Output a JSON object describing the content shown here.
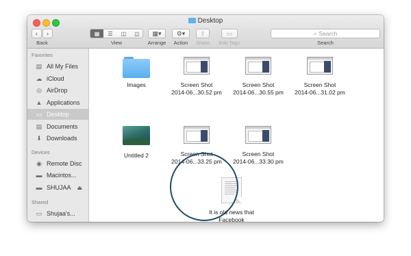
{
  "window": {
    "title": "Desktop"
  },
  "toolbar": {
    "back_label": "Back",
    "view_label": "View",
    "arrange_label": "Arrange",
    "action_label": "Action",
    "share_label": "Share",
    "edit_tags_label": "Edit Tags",
    "search_label": "Search",
    "search_placeholder": "Search"
  },
  "sidebar": {
    "sections": [
      {
        "title": "Favorites",
        "items": [
          {
            "label": "All My Files",
            "icon": "all-files-icon"
          },
          {
            "label": "iCloud",
            "icon": "cloud-icon"
          },
          {
            "label": "AirDrop",
            "icon": "airdrop-icon"
          },
          {
            "label": "Applications",
            "icon": "applications-icon"
          },
          {
            "label": "Desktop",
            "icon": "desktop-icon",
            "selected": true
          },
          {
            "label": "Documents",
            "icon": "documents-icon"
          },
          {
            "label": "Downloads",
            "icon": "downloads-icon"
          }
        ]
      },
      {
        "title": "Devices",
        "items": [
          {
            "label": "Remote Disc",
            "icon": "disc-icon"
          },
          {
            "label": "Macintos...",
            "icon": "hard-drive-icon"
          },
          {
            "label": "SHUJAA",
            "icon": "usb-drive-icon",
            "eject": true
          }
        ]
      },
      {
        "title": "Shared",
        "items": [
          {
            "label": "Shujaa's...",
            "icon": "computer-icon"
          }
        ]
      }
    ]
  },
  "files": [
    {
      "name": "Images",
      "type": "folder"
    },
    {
      "name": "Screen Shot",
      "name2": "2014-06...30.52 pm",
      "type": "screenshot"
    },
    {
      "name": "Screen Shot",
      "name2": "2014-06...30.55 pm",
      "type": "screenshot"
    },
    {
      "name": "Screen Shot",
      "name2": "2014-06...31.02 pm",
      "type": "screenshot"
    },
    {
      "name": "Untitled 2",
      "type": "image"
    },
    {
      "name": "Screen Shot",
      "name2": "2014-06...33.25 pm",
      "type": "screenshot"
    },
    {
      "name": "Screen Shot",
      "name2": "2014-06...33.30 pm",
      "type": "screenshot"
    },
    {
      "name": "It is old news that",
      "name2": "Facebook",
      "type": "text-document"
    }
  ],
  "colors": {
    "highlight_ring": "#1e4a66",
    "folder": "#58aef0"
  }
}
